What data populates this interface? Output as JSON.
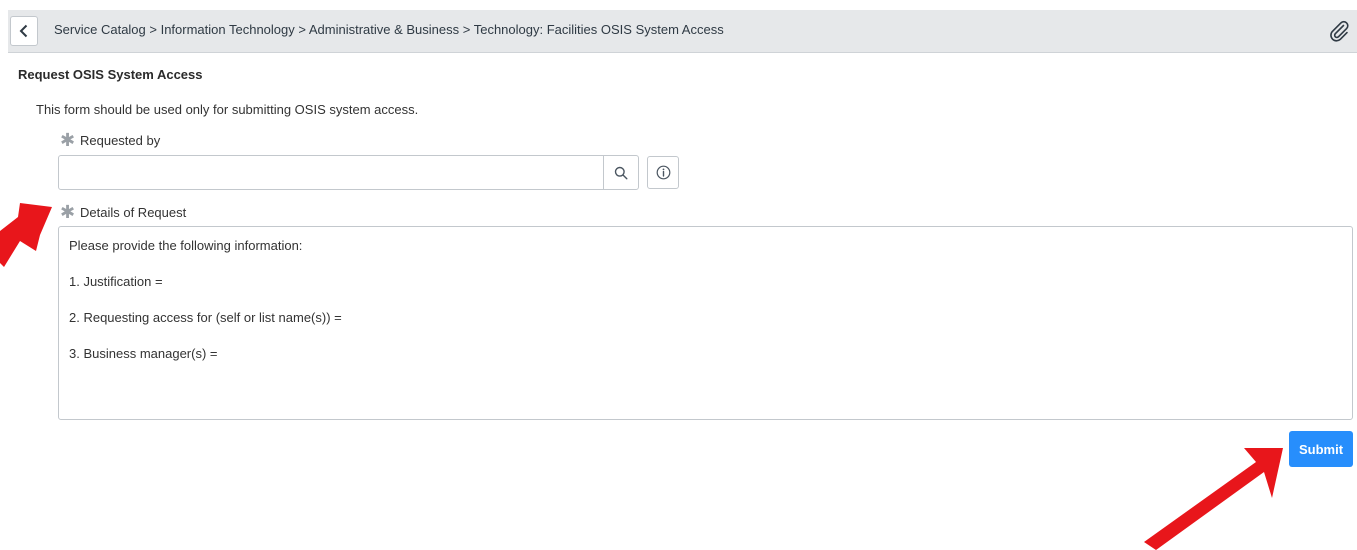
{
  "topbar": {
    "breadcrumb": "Service Catalog > Information Technology > Administrative & Business > Technology: Facilities OSIS System Access",
    "back_icon": "chevron-left-icon",
    "attachment_icon": "paperclip-icon"
  },
  "form": {
    "title": "Request OSIS System Access",
    "intro": "This form should be used only for submitting OSIS system access.",
    "requested_by": {
      "label": "Requested by",
      "value": "",
      "lookup_icon": "search-icon",
      "info_icon": "info-icon"
    },
    "details": {
      "label": "Details of Request",
      "lines": [
        "Please provide the following information:",
        "1. Justification =",
        "2. Requesting access for (self or list name(s)) =",
        "3. Business manager(s) ="
      ]
    },
    "submit_label": "Submit"
  },
  "colors": {
    "topbar_bg": "#e6e8ea",
    "submit_bg": "#278efc",
    "annotation_arrow": "#e8161b"
  }
}
